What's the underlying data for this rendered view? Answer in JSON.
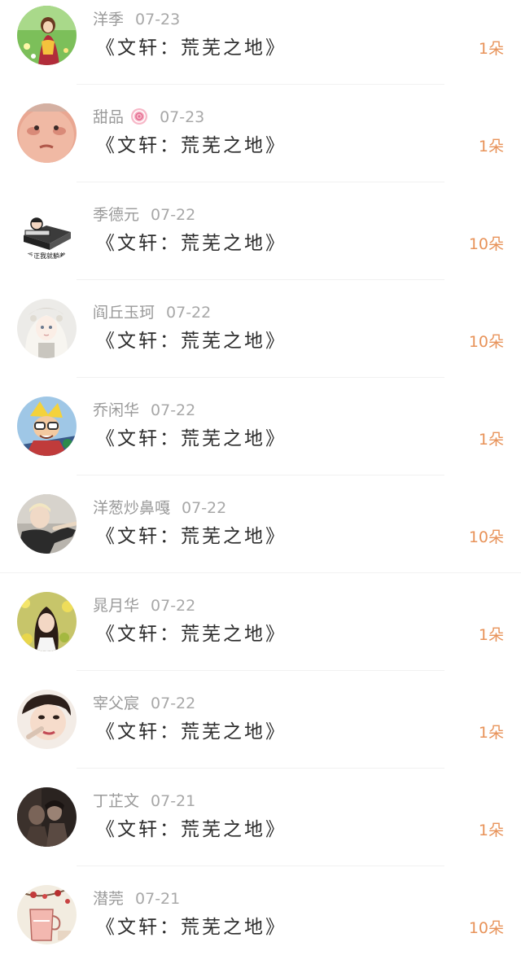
{
  "gifts": [
    {
      "name": "洋季",
      "date": "07-23",
      "title": "《文轩：荒芜之地》",
      "count": "1朵",
      "avatar": "avatar-girl-field"
    },
    {
      "name": "甜品",
      "date": "07-23",
      "title": "《文轩：荒芜之地》",
      "count": "1朵",
      "avatar": "avatar-baby-face",
      "emoji": "lollipop-icon"
    },
    {
      "name": "季德元",
      "date": "07-22",
      "title": "《文轩：荒芜之地》",
      "count": "10朵",
      "avatar": "avatar-bed-meme",
      "avatar_text": "反正我就躺着"
    },
    {
      "name": "阎丘玉珂",
      "date": "07-22",
      "title": "《文轩：荒芜之地》",
      "count": "10朵",
      "avatar": "avatar-anime-girl"
    },
    {
      "name": "乔闲华",
      "date": "07-22",
      "title": "《文轩：荒芜之地》",
      "count": "1朵",
      "avatar": "avatar-game-hero"
    },
    {
      "name": "洋葱炒鼻嘎",
      "date": "07-22",
      "title": "《文轩：荒芜之地》",
      "count": "10朵",
      "avatar": "avatar-wizard"
    },
    {
      "name": "晁月华",
      "date": "07-22",
      "title": "《文轩：荒芜之地》",
      "count": "1朵",
      "avatar": "avatar-girl-flowers"
    },
    {
      "name": "宰父宸",
      "date": "07-22",
      "title": "《文轩：荒芜之地》",
      "count": "1朵",
      "avatar": "avatar-woman-portrait"
    },
    {
      "name": "丁芷文",
      "date": "07-21",
      "title": "《文轩：荒芜之地》",
      "count": "1朵",
      "avatar": "avatar-dark-couple"
    },
    {
      "name": "潜莞",
      "date": "07-21",
      "title": "《文轩：荒芜之地》",
      "count": "10朵",
      "avatar": "avatar-cup-illustration"
    }
  ],
  "colors": {
    "name": "#9a9a9a",
    "title": "#2d2d2d",
    "count": "#e8935a",
    "separator": "#f1f1f1"
  }
}
